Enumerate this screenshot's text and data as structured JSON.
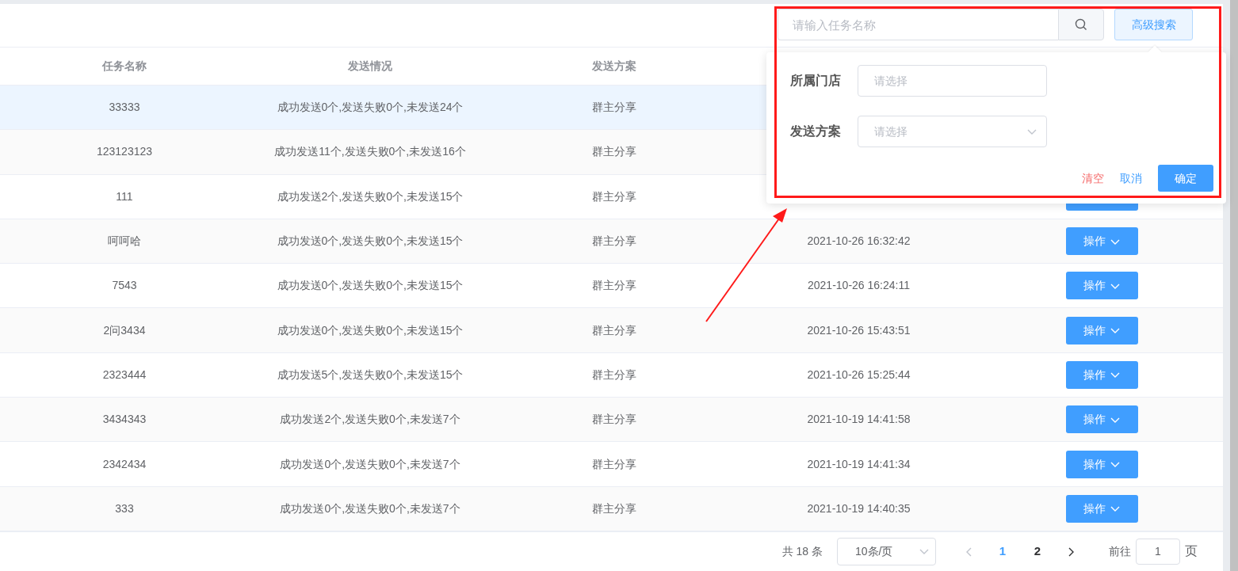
{
  "toolbar": {
    "search": {
      "placeholder": "请输入任务名称"
    },
    "advanced_button": "高级搜索"
  },
  "table": {
    "columns": [
      "任务名称",
      "发送情况",
      "发送方案"
    ],
    "rows": [
      {
        "name": "33333",
        "status": "成功发送0个,发送失败0个,未发送24个",
        "plan": "群主分享",
        "selected": true
      },
      {
        "name": "123123123",
        "status": "成功发送11个,发送失败0个,未发送16个",
        "plan": "群主分享",
        "selected": false
      },
      {
        "name": "111",
        "status": "成功发送2个,发送失败0个,未发送15个",
        "plan": "群主分享",
        "kind": "covered",
        "selected": false
      },
      {
        "name": "呵呵哈",
        "status": "成功发送0个,发送失败0个,未发送15个",
        "plan": "群主分享",
        "time": "2021-10-26 16:32:42",
        "action": "操作",
        "kind": "menu",
        "selected": false
      },
      {
        "name": "7543",
        "status": "成功发送0个,发送失败0个,未发送15个",
        "plan": "群主分享",
        "time": "2021-10-26 16:24:11",
        "action": "操作",
        "kind": "menu",
        "selected": false
      },
      {
        "name": "2问3434",
        "status": "成功发送0个,发送失败0个,未发送15个",
        "plan": "群主分享",
        "time": "2021-10-26 15:43:51",
        "action": "操作",
        "kind": "menu",
        "selected": false
      },
      {
        "name": "2323444",
        "status": "成功发送5个,发送失败0个,未发送15个",
        "plan": "群主分享",
        "time": "2021-10-26 15:25:44",
        "action": "操作",
        "kind": "menu",
        "selected": false
      },
      {
        "name": "3434343",
        "status": "成功发送2个,发送失败0个,未发送7个",
        "plan": "群主分享",
        "time": "2021-10-19 14:41:58",
        "action": "操作",
        "kind": "menu",
        "selected": false
      },
      {
        "name": "2342434",
        "status": "成功发送0个,发送失败0个,未发送7个",
        "plan": "群主分享",
        "time": "2021-10-19 14:41:34",
        "action": "操作",
        "kind": "menu",
        "selected": false
      },
      {
        "name": "333",
        "status": "成功发送0个,发送失败0个,未发送7个",
        "plan": "群主分享",
        "time": "2021-10-19 14:40:35",
        "action": "操作",
        "kind": "menu",
        "selected": false
      }
    ]
  },
  "popover": {
    "fields": [
      {
        "label": "所属门店",
        "placeholder": "请选择",
        "kind": "input"
      },
      {
        "label": "发送方案",
        "placeholder": "请选择",
        "kind": "select"
      }
    ],
    "buttons": [
      {
        "label": "清空",
        "kind": "danger-text"
      },
      {
        "label": "取消",
        "kind": "text"
      },
      {
        "label": "确定",
        "kind": "primary"
      }
    ]
  },
  "pagination": {
    "total": "共 18 条",
    "page_size": "10条/页",
    "pages": [
      {
        "label": "1",
        "selected": true
      },
      {
        "label": "2",
        "selected": false
      }
    ],
    "goto_label": "前往",
    "goto_value": "1",
    "goto_suffix": "页"
  }
}
